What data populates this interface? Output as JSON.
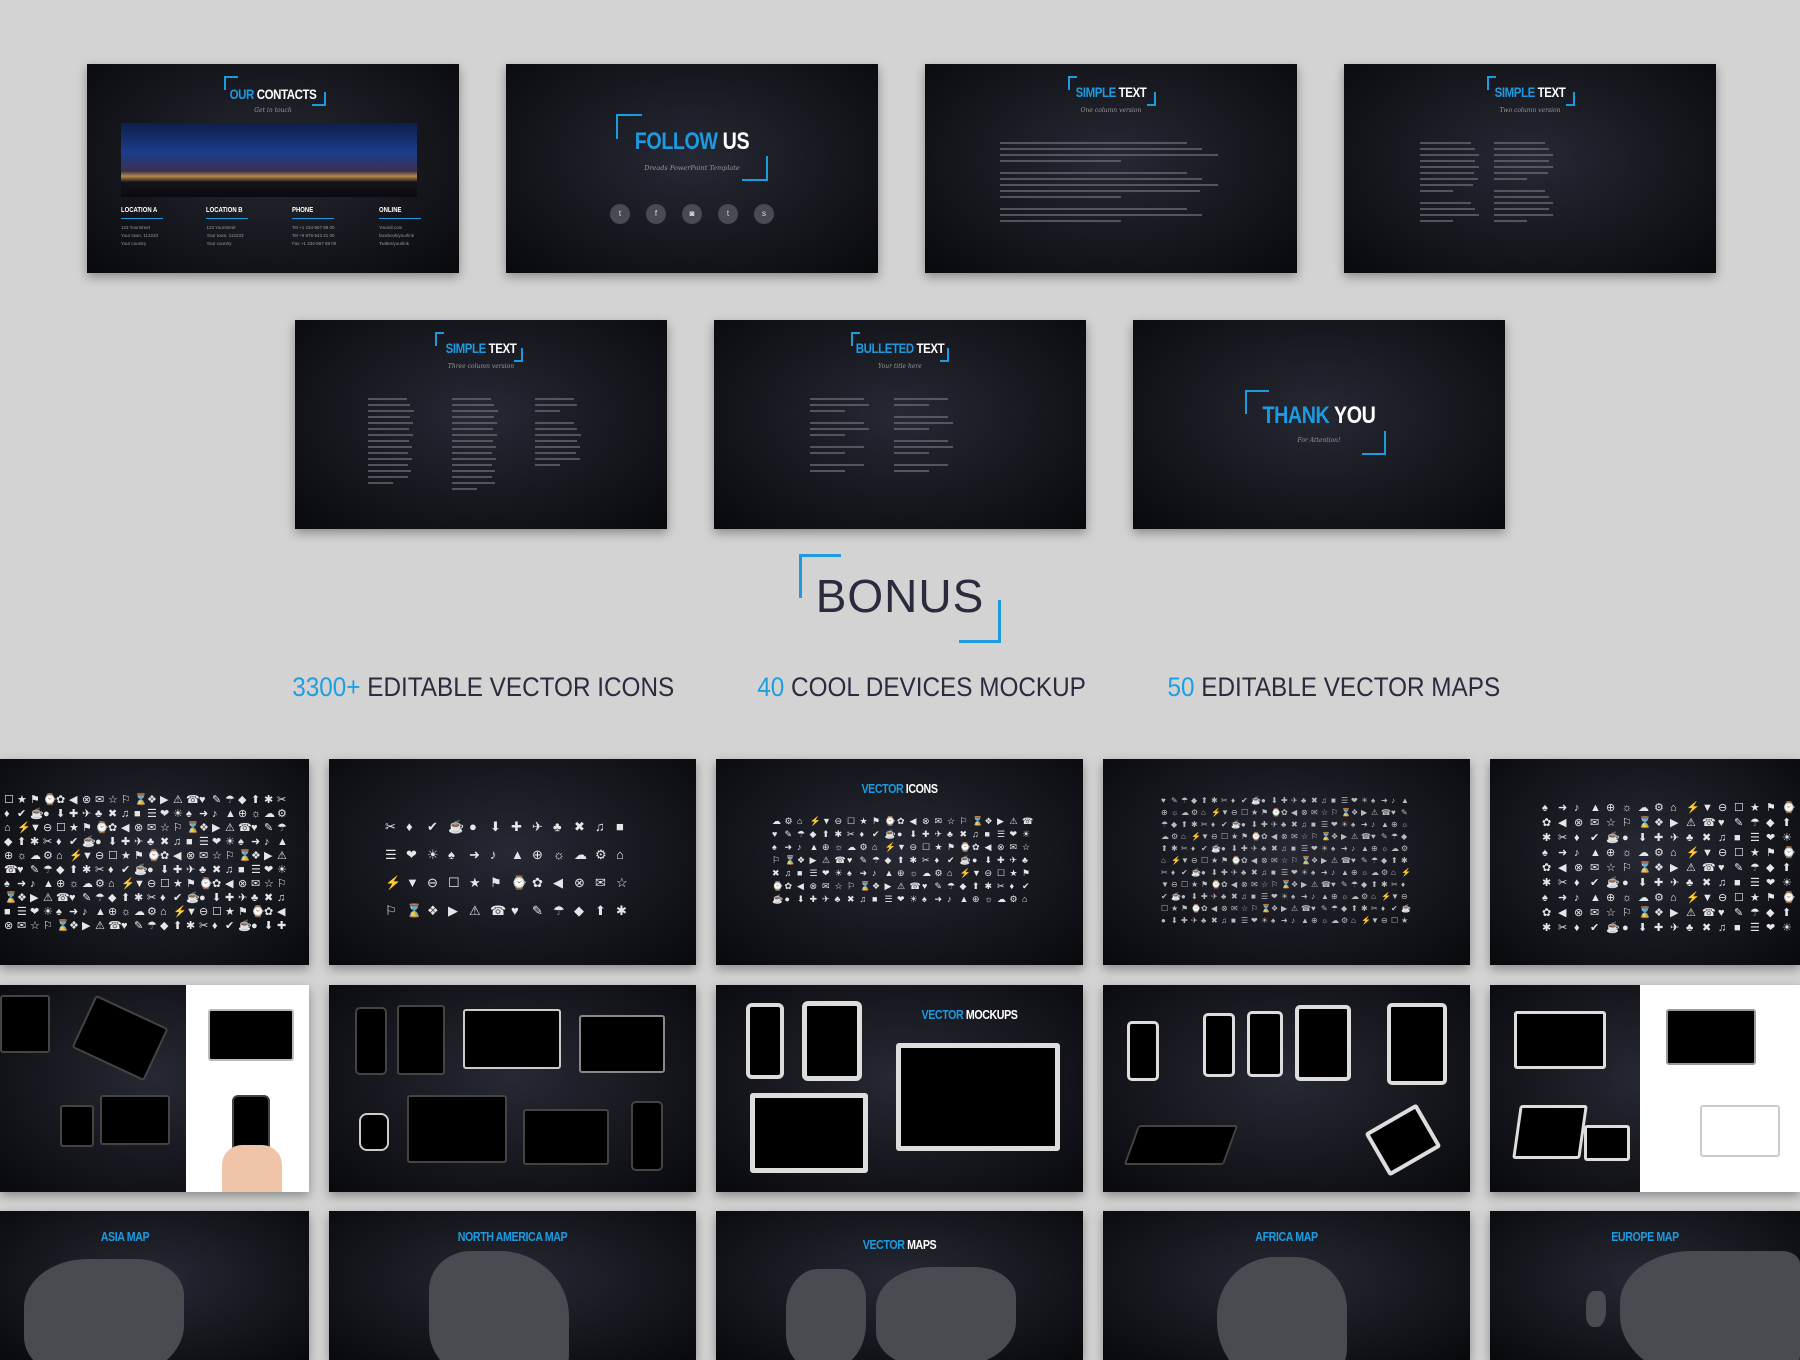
{
  "accent": "#1e9be0",
  "slides": {
    "contacts": {
      "title_a": "OUR",
      "title_b": "CONTACTS",
      "subtitle": "Get in touch",
      "columns": [
        {
          "heading": "LOCATION A",
          "lines": [
            "123 Yourstreet",
            "Your town, 112233",
            "Your country"
          ]
        },
        {
          "heading": "LOCATION B",
          "lines": [
            "123 Yourstreet",
            "Your town, 112233",
            "Your country"
          ]
        },
        {
          "heading": "PHONE",
          "lines": [
            "Tel +1 234-567 89 00",
            "Tel +9 876-543 21 00",
            "Fax +1 234-567 89 00"
          ]
        },
        {
          "heading": "ONLINE",
          "lines": [
            "Yourall.com",
            "facebook/yourlink",
            "Twitter/yourlink"
          ]
        }
      ]
    },
    "follow": {
      "title_a": "FOLLOW",
      "title_b": "US",
      "subtitle": "Dreads PowerPoint Template",
      "social_icons": [
        "twitter-icon",
        "facebook-icon",
        "instagram-icon",
        "tumblr-icon",
        "skype-icon"
      ]
    },
    "simple1": {
      "title_a": "SIMPLE",
      "title_b": "TEXT",
      "subtitle": "One column version"
    },
    "simple2": {
      "title_a": "SIMPLE",
      "title_b": "TEXT",
      "subtitle": "Two column version"
    },
    "simple3": {
      "title_a": "SIMPLE",
      "title_b": "TEXT",
      "subtitle": "Three column version"
    },
    "bulleted": {
      "title_a": "BULLETED",
      "title_b": "TEXT",
      "subtitle": "Your title here"
    },
    "thanks": {
      "title_a": "THANK",
      "title_b": "YOU",
      "subtitle": "For Attention!"
    }
  },
  "bonus": {
    "title": "BONUS",
    "features": [
      {
        "num": "3300+",
        "text": "EDITABLE VECTOR ICONS"
      },
      {
        "num": "40",
        "text": "COOL DEVICES MOCKUP"
      },
      {
        "num": "50",
        "text": "EDITABLE VECTOR MAPS"
      }
    ]
  },
  "gallery": {
    "icons_title_a": "VECTOR",
    "icons_title_b": "ICONS",
    "mockups_title_a": "VECTOR",
    "mockups_title_b": "MOCKUPS",
    "maps": [
      {
        "title": "ASIA MAP"
      },
      {
        "title": "NORTH AMERICA MAP"
      },
      {
        "title_a": "VECTOR",
        "title_b": "MAPS"
      },
      {
        "title": "AFRICA MAP"
      },
      {
        "title": "EUROPE MAP"
      }
    ]
  }
}
